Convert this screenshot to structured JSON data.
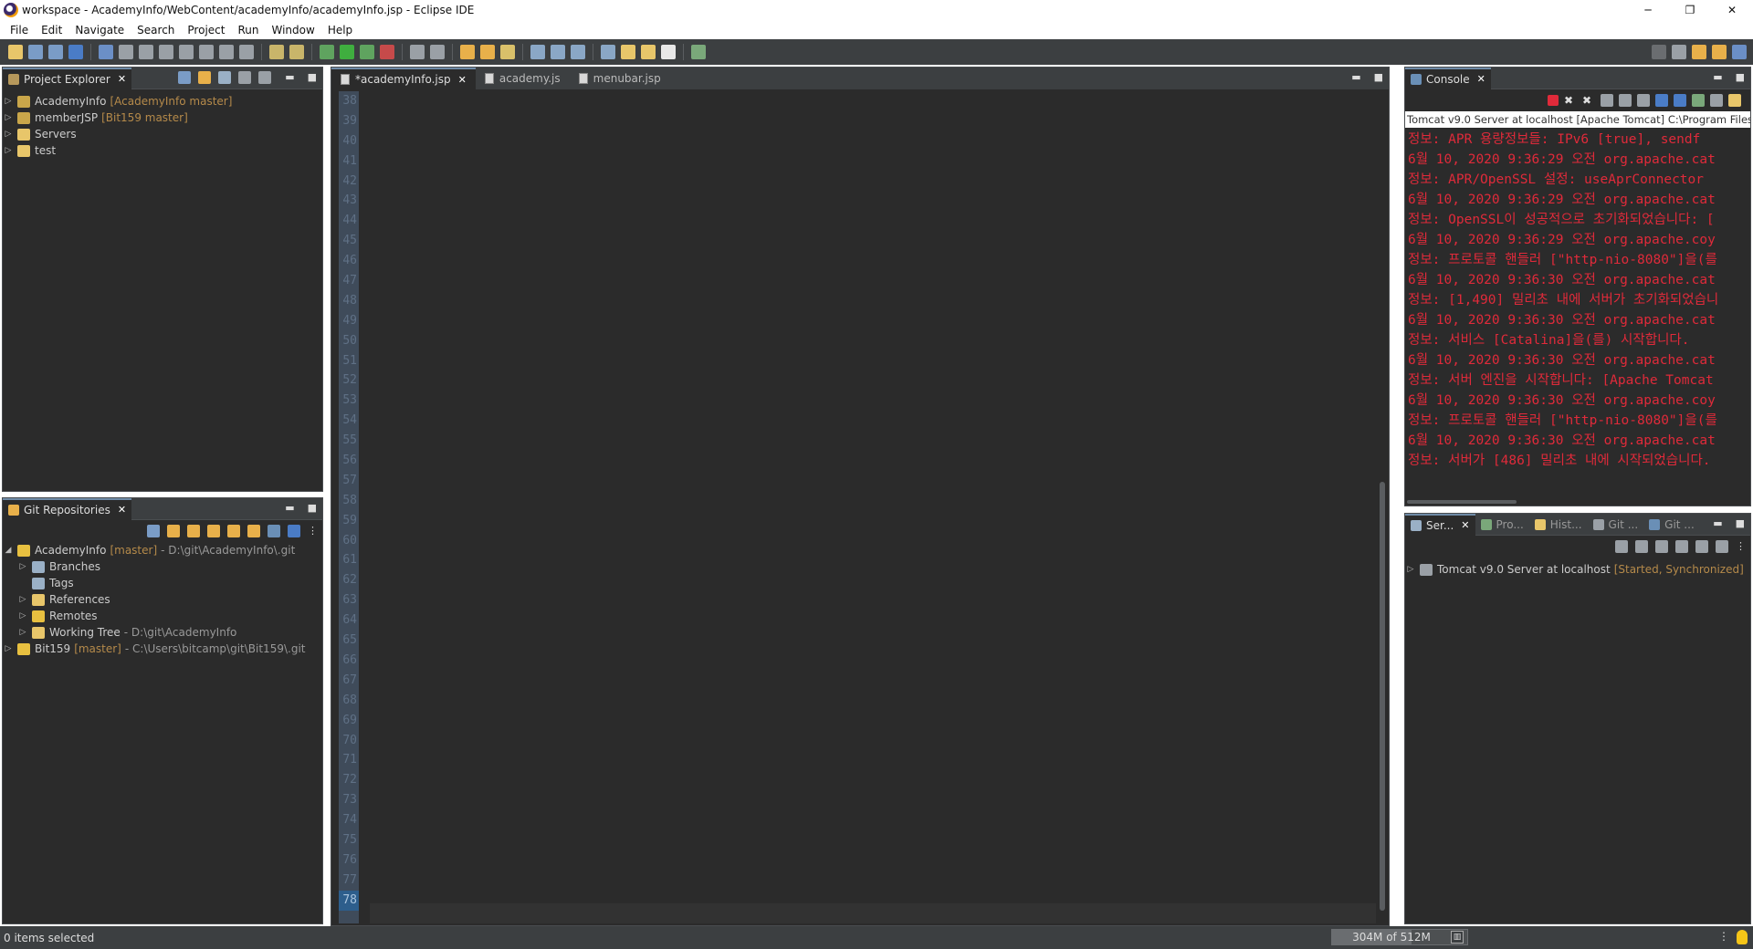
{
  "window": {
    "title": "workspace - AcademyInfo/WebContent/academyInfo/academyInfo.jsp - Eclipse IDE",
    "controls": {
      "minimize": "─",
      "restore": "❐",
      "close": "✕"
    }
  },
  "menu": [
    "File",
    "Edit",
    "Navigate",
    "Search",
    "Project",
    "Run",
    "Window",
    "Help"
  ],
  "project_explorer": {
    "tab_label": "Project Explorer",
    "items": [
      {
        "label": "AcademyInfo",
        "decoration": "[AcademyInfo master]"
      },
      {
        "label": "memberJSP",
        "decoration": "[Bit159 master]"
      },
      {
        "label": "Servers",
        "decoration": ""
      },
      {
        "label": "test",
        "decoration": ""
      }
    ]
  },
  "git_repositories": {
    "tab_label": "Git Repositories",
    "repo1": {
      "name": "AcademyInfo",
      "branch": "[master]",
      "path": "- D:\\git\\AcademyInfo\\.git"
    },
    "children": [
      {
        "label": "Branches",
        "path": ""
      },
      {
        "label": "Tags",
        "path": ""
      },
      {
        "label": "References",
        "path": ""
      },
      {
        "label": "Remotes",
        "path": ""
      },
      {
        "label": "Working Tree",
        "path": "- D:\\git\\AcademyInfo"
      }
    ],
    "repo2": {
      "name": "Bit159",
      "branch": "[master]",
      "path": "- C:\\Users\\bitcamp\\git\\Bit159\\.git"
    }
  },
  "editor": {
    "tabs": [
      {
        "label": "*academyInfo.jsp",
        "close": "✕"
      },
      {
        "label": "academy.js"
      },
      {
        "label": "menubar.jsp"
      }
    ],
    "line_numbers": [
      "38",
      "39",
      "40",
      "41",
      "42",
      "43",
      "44",
      "45",
      "46",
      "47",
      "48",
      "49",
      "50",
      "51",
      "52",
      "53",
      "54",
      "55",
      "56",
      "57",
      "58",
      "59",
      "60",
      "61",
      "62",
      "63",
      "64",
      "65",
      "66",
      "67",
      "68",
      "69",
      "70",
      "71",
      "72",
      "73",
      "74",
      "75",
      "76",
      "77",
      "78"
    ],
    "current_line": "78"
  },
  "console": {
    "tab_label": "Console",
    "server_path": "Tomcat v9.0 Server at localhost [Apache Tomcat] C:\\Program Files\\J",
    "lines": [
      "정보: APR 용량정보들: IPv6 [true], sendf",
      "6월 10, 2020 9:36:29 오전 org.apache.cat",
      "정보: APR/OpenSSL 설정: useAprConnector",
      "6월 10, 2020 9:36:29 오전 org.apache.cat",
      "정보: OpenSSL이 성공적으로 초기화되었습니다: [",
      "6월 10, 2020 9:36:29 오전 org.apache.coy",
      "정보: 프로토콜 핸들러 [\"http-nio-8080\"]을(를",
      "6월 10, 2020 9:36:30 오전 org.apache.cat",
      "정보: [1,490] 밀리초 내에 서버가 초기화되었습니",
      "6월 10, 2020 9:36:30 오전 org.apache.cat",
      "정보: 서비스 [Catalina]을(를) 시작합니다.",
      "6월 10, 2020 9:36:30 오전 org.apache.cat",
      "정보: 서버 엔진을 시작합니다: [Apache Tomcat",
      "6월 10, 2020 9:36:30 오전 org.apache.coy",
      "정보: 프로토콜 핸들러 [\"http-nio-8080\"]을(를",
      "6월 10, 2020 9:36:30 오전 org.apache.cat",
      "정보: 서버가 [486] 밀리초 내에 시작되었습니다."
    ]
  },
  "servers": {
    "tabs": [
      "Ser...",
      "Pro...",
      "Hist...",
      "Git ...",
      "Git ..."
    ],
    "item": {
      "label": "Tomcat v9.0 Server at localhost",
      "status": "[Started, Synchronized]"
    }
  },
  "status": {
    "selection": "0 items selected",
    "heap": "304M of 512M",
    "heap_used_fraction": 0.59
  },
  "colors": {
    "console_error": "#e02a3a",
    "decoration": "#b58a4a",
    "background": "#2b2b2b"
  }
}
